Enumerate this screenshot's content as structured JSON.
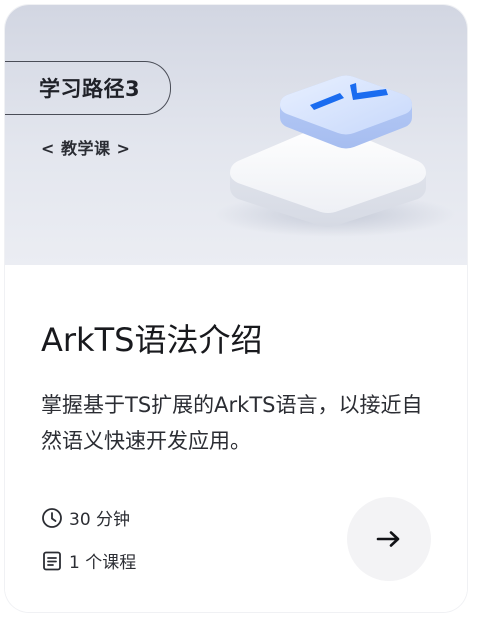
{
  "banner": {
    "path_label": "学习路径3",
    "course_type": "< 教学课 >"
  },
  "course": {
    "title": "ArkTS语法介绍",
    "description": "掌握基于TS扩展的ArkTS语言，以接近自然语义快速开发应用。"
  },
  "meta": {
    "duration": "30 分钟",
    "course_count": "1 个课程"
  },
  "icons": {
    "duration": "clock-icon",
    "courses": "document-icon",
    "action": "arrow-right-icon"
  },
  "colors": {
    "accent": "#1a73e8",
    "banner_bg": "#dde0e9",
    "button_bg": "#f3f3f5",
    "text": "#18191d"
  }
}
